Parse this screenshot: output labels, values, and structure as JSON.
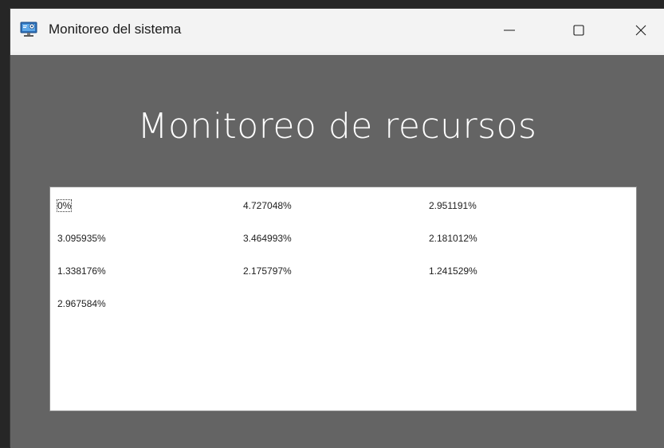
{
  "window": {
    "title": "Monitoreo del sistema",
    "icon": "computer-monitor-icon",
    "controls": [
      "minimize-icon",
      "maximize-icon",
      "close-icon"
    ]
  },
  "main": {
    "heading": "Monitoreo de recursos",
    "values": [
      "0%",
      "4.727048%",
      "2.951191%",
      "3.095935%",
      "3.464993%",
      "2.181012%",
      "1.338176%",
      "2.175797%",
      "1.241529%",
      "2.967584%"
    ]
  },
  "colors": {
    "background": "#646464",
    "panel": "#ffffff",
    "heading": "#ffffff"
  }
}
